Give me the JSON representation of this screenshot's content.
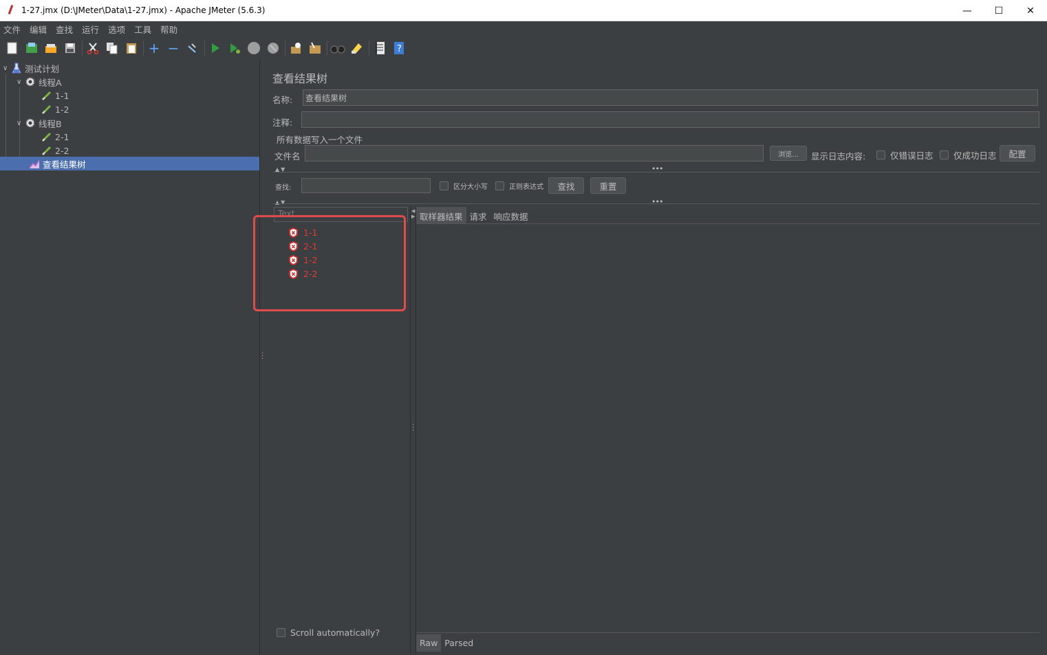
{
  "window": {
    "title": "1-27.jmx (D:\\JMeter\\Data\\1-27.jmx) - Apache JMeter (5.6.3)",
    "minimize": "—",
    "maximize": "☐",
    "close": "✕"
  },
  "menu": [
    "文件",
    "编辑",
    "查找",
    "运行",
    "选项",
    "工具",
    "帮助"
  ],
  "toolbar": [
    "new-icon",
    "templates-icon",
    "open-icon",
    "save-icon",
    "cut-icon",
    "copy-icon",
    "paste-icon",
    "expand-icon",
    "collapse-icon",
    "toggle-icon",
    "start-icon",
    "start-no-pause-icon",
    "stop-icon",
    "shutdown-icon",
    "clear-icon",
    "clear-all-icon",
    "search-icon",
    "reset-search-icon",
    "function-helper-icon",
    "help-icon"
  ],
  "tree": {
    "root": "测试计划",
    "thread_a": "线程A",
    "a1": "1-1",
    "a2": "1-2",
    "thread_b": "线程B",
    "b1": "2-1",
    "b2": "2-2",
    "listener": "查看结果树"
  },
  "panel": {
    "title": "查看结果树",
    "name_label": "名称:",
    "name_value": "查看结果树",
    "comment_label": "注释:",
    "comment_value": "",
    "file_section": "所有数据写入一个文件",
    "filename_label": "文件名",
    "filename_value": "",
    "browse": "浏览...",
    "log_content_label": "显示日志内容:",
    "errors_only": "仅错误日志",
    "success_only": "仅成功日志",
    "configure": "配置",
    "search_label": "查找:",
    "search_value": "",
    "case_sensitive": "区分大小写",
    "regex": "正则表达式",
    "find_button": "查找",
    "reset_button": "重置"
  },
  "results": {
    "filter_placeholder": "Text",
    "items": [
      "1-1",
      "2-1",
      "1-2",
      "2-2"
    ],
    "status_color": "#e53935",
    "scroll_auto": "Scroll automatically?"
  },
  "tabs": [
    "取样器结果",
    "请求",
    "响应数据"
  ],
  "bottom_tabs": [
    "Raw",
    "Parsed"
  ]
}
